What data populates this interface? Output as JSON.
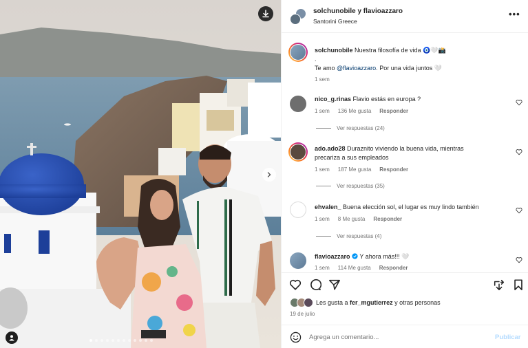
{
  "post": {
    "header": {
      "username": "solchunobile y flavioazzaro",
      "location": "Santorini Greece"
    },
    "caption": {
      "username": "solchunobile",
      "text": "Nuestra filosofía de vida 🧿🤍📸",
      "dot": ".",
      "line2_prefix": "Te amo ",
      "mention": "@flavioazzaro",
      "line2_suffix": ". Por una vida juntos 🤍",
      "time": "1 sem"
    },
    "comments": [
      {
        "username": "nico_g.rinas",
        "text": "Flavio estás en europa ?",
        "time": "1 sem",
        "likes": "136 Me gusta",
        "reply": "Responder",
        "view_replies": "Ver respuestas (24)"
      },
      {
        "username": "ado.ado28",
        "text": "Duraznito viviendo la buena vida, mientras precariza a sus empleados",
        "time": "1 sem",
        "likes": "187 Me gusta",
        "reply": "Responder",
        "view_replies": "Ver respuestas (35)"
      },
      {
        "username": "ehvalen_",
        "text": "Buena elección sol, el lugar es muy lindo también",
        "time": "1 sem",
        "likes": "8 Me gusta",
        "reply": "Responder",
        "view_replies": "Ver respuestas (4)"
      },
      {
        "username": "flavioazzaro",
        "text": "Y ahora más!!! 🤍",
        "time": "1 sem",
        "likes": "114 Me gusta",
        "reply": "Responder"
      }
    ],
    "likes": {
      "prefix": "Les gusta a ",
      "user": "fer_mgutierrez",
      "suffix": " y otras personas"
    },
    "date": "19 de julio",
    "comment_box": {
      "placeholder": "Agrega un comentario...",
      "publish_label": "Publicar"
    },
    "carousel": {
      "slide_count": 12,
      "active_index": 0
    }
  },
  "colors": {
    "link": "#00376b",
    "muted": "#737373",
    "publish_disabled": "#b3dbff",
    "border": "#efefef"
  },
  "icons": {
    "download": "download-icon",
    "next": "chevron-right-icon",
    "user_tag": "user-tag-icon",
    "more": "more-options-icon",
    "heart": "heart-icon",
    "comment": "comment-icon",
    "share": "share-icon",
    "repost": "repost-icon",
    "save": "bookmark-icon",
    "emoji": "emoji-icon",
    "verified": "verified-badge-icon"
  }
}
